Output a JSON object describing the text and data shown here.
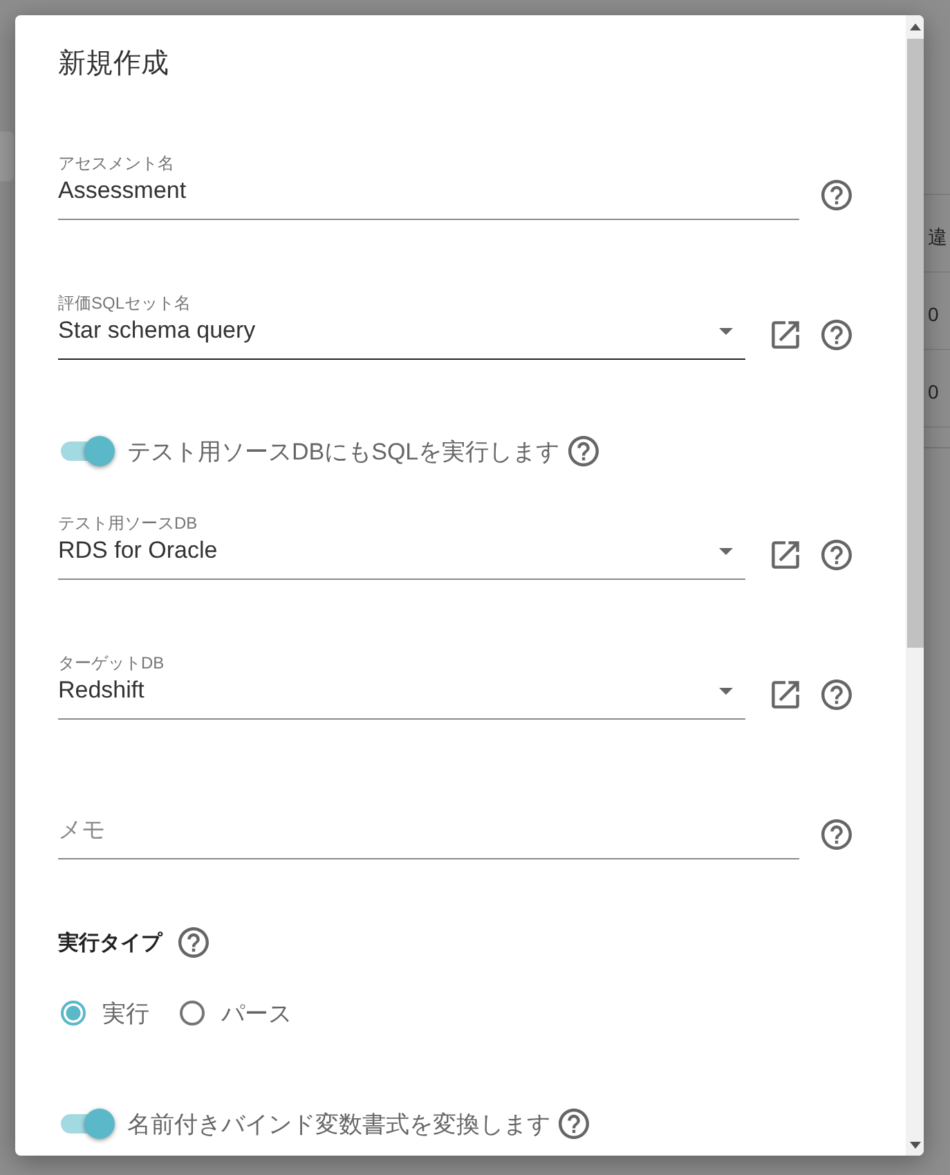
{
  "background": {
    "texts": [
      "違",
      "0",
      "0"
    ]
  },
  "dialog": {
    "title": "新規作成",
    "items": [
      {
        "kind": "text",
        "label": "アセスメント名",
        "value": "Assessment",
        "focused": false
      },
      {
        "kind": "select",
        "label": "評価SQLセット名",
        "value": "Star schema query",
        "focused": true
      },
      {
        "kind": "toggle",
        "label": "テスト用ソースDBにもSQLを実行します",
        "on": true
      },
      {
        "kind": "select",
        "label": "テスト用ソースDB",
        "value": "RDS for Oracle",
        "focused": false
      },
      {
        "kind": "select",
        "label": "ターゲットDB",
        "value": "Redshift",
        "focused": false
      },
      {
        "kind": "text",
        "placeholder": "メモ",
        "focused": false
      },
      {
        "kind": "section",
        "label": "実行タイプ"
      },
      {
        "kind": "radio",
        "options": [
          {
            "label": "実行",
            "selected": true
          },
          {
            "label": "パース",
            "selected": false
          }
        ]
      },
      {
        "kind": "toggle",
        "label": "名前付きバインド変数書式を変換します",
        "on": true
      }
    ]
  }
}
